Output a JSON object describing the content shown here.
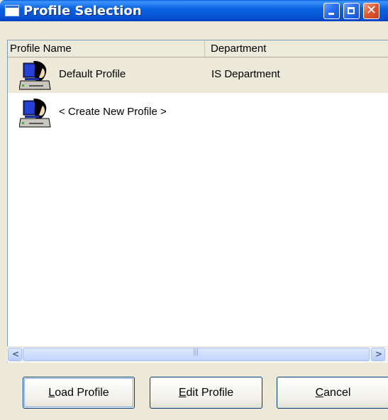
{
  "window": {
    "title": "Profile Selection",
    "icon": "window-icon",
    "controls": [
      "minimize-icon",
      "maximize-icon",
      "close-icon"
    ]
  },
  "list": {
    "columns": [
      "Profile Name",
      "Department"
    ],
    "rows": [
      {
        "name": "Default Profile",
        "department": "IS Department",
        "icon": "computer-user-icon",
        "selected": true
      },
      {
        "name": "< Create New Profile >",
        "department": "",
        "icon": "computer-user-icon",
        "selected": false
      }
    ]
  },
  "scrollbar": {
    "grip": "|||"
  },
  "buttons": {
    "load": {
      "mnemonic": "L",
      "rest": "oad Profile"
    },
    "edit": {
      "mnemonic": "E",
      "rest": "dit Profile"
    },
    "cancel": {
      "mnemonic": "C",
      "rest": "ancel"
    }
  },
  "colors": {
    "titlebar": "#0a63e0",
    "dialog": "#ece9d8",
    "selection": "#ece9d8",
    "close": "#e05a36"
  }
}
